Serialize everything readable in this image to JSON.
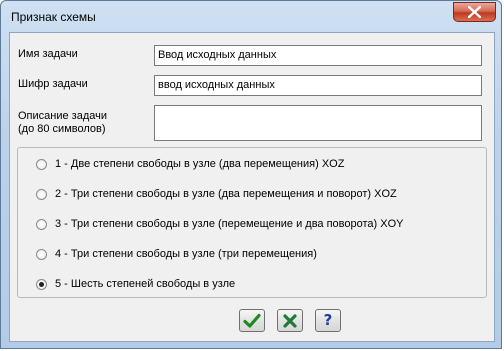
{
  "window": {
    "title": "Признак схемы"
  },
  "form": {
    "task_name_label": "Имя задачи",
    "task_name_value": "Ввод исходных данных",
    "task_code_label": "Шифр задачи",
    "task_code_value": "ввод исходных данных",
    "task_desc_label_line1": "Описание задачи",
    "task_desc_label_line2": "(до 80 символов)",
    "task_desc_value": ""
  },
  "scheme_options": [
    {
      "label": "1 - Две степени свободы в узле (два перемещения) XOZ",
      "checked": false
    },
    {
      "label": "2 - Три степени свободы в узле (два перемещения и поворот) XOZ",
      "checked": false
    },
    {
      "label": "3 - Три степени свободы в узле (перемещение и два поворота) XOY",
      "checked": false
    },
    {
      "label": "4 - Три степени свободы в узле (три перемещения)",
      "checked": false
    },
    {
      "label": "5 - Шесть степеней свободы в узле",
      "checked": true
    }
  ],
  "buttons": {
    "ok_icon": "checkmark-icon",
    "cancel_icon": "cross-icon",
    "help_icon": "question-icon",
    "help_glyph": "?"
  },
  "colors": {
    "ok_green": "#1f8a1f",
    "cancel_green": "#1f7a3a",
    "help_blue": "#1c3fa0"
  }
}
